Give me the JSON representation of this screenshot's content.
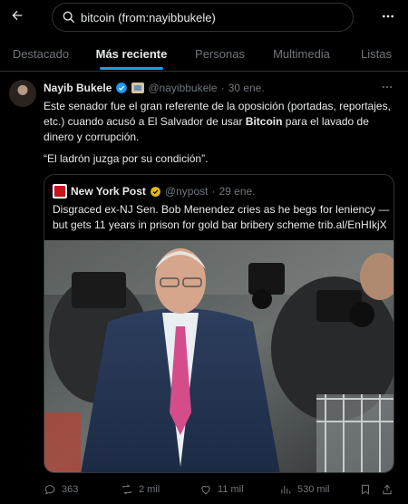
{
  "search": {
    "query": "bitcoin (from:nayibbukele)"
  },
  "tabs": [
    {
      "label": "Destacado"
    },
    {
      "label": "Más reciente"
    },
    {
      "label": "Personas"
    },
    {
      "label": "Multimedia"
    },
    {
      "label": "Listas"
    }
  ],
  "active_tab": "Más reciente",
  "tweet": {
    "name": "Nayib Bukele",
    "handle": "@nayibbukele",
    "separator": "·",
    "date": "30 ene.",
    "text_1": "Este senador fue el gran referente de la oposición (portadas, reportajes, etc.) cuando acusó a El Salvador de usar ",
    "text_bold": "Bitcoin",
    "text_2": " para el lavado de dinero y corrupción.",
    "quote_line": "“El ladrón juzga por su condición”.",
    "quoted": {
      "name": "New York Post",
      "handle": "@nypost",
      "separator": "·",
      "date": "29 ene.",
      "text": "Disgraced ex-NJ Sen. Bob Menendez cries as he begs for leniency — but gets 11 years in prison for gold bar bribery scheme trib.al/EnHIkjX"
    },
    "actions": {
      "replies": "363",
      "reposts": "2 mil",
      "likes": "11 mil",
      "views": "530 mil"
    }
  },
  "colors": {
    "accent": "#1d9bf0",
    "verified_gold": "#e2b719",
    "muted": "#71767b"
  },
  "icons": [
    "back-arrow-icon",
    "search-icon",
    "more-icon",
    "verified-icon",
    "affiliate-badge-icon",
    "reply-icon",
    "repost-icon",
    "like-icon",
    "views-icon",
    "bookmark-icon",
    "share-icon"
  ]
}
